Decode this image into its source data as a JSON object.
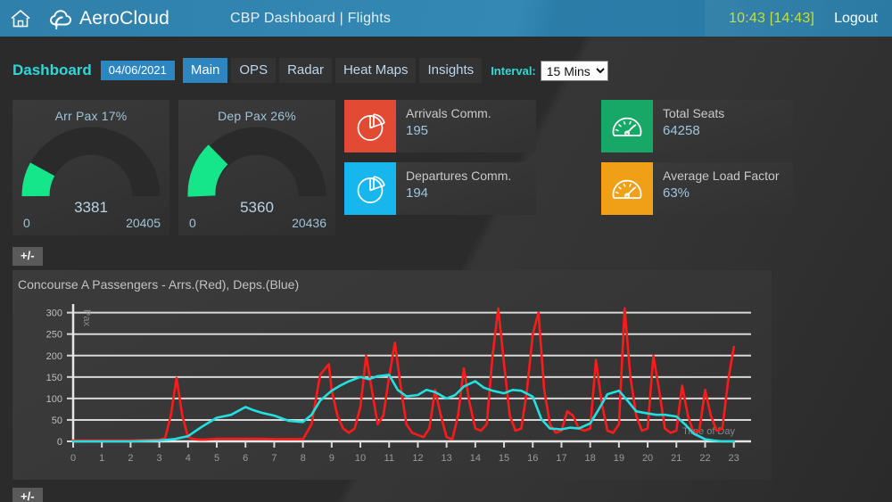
{
  "header": {
    "home_icon": "home-icon",
    "logo_icon": "aerocloud-logo-icon",
    "brand": "AeroCloud",
    "title": "CBP Dashboard | Flights",
    "clock": "10:43 [14:43]",
    "logout": "Logout",
    "clock_color": "#c5de3c",
    "bar_color": "#3389b4"
  },
  "nav": {
    "brand": "Dashboard",
    "date": "04/06/2021",
    "tabs": [
      {
        "label": "Main",
        "active": true
      },
      {
        "label": "OPS",
        "active": false
      },
      {
        "label": "Radar",
        "active": false
      },
      {
        "label": "Heat Maps",
        "active": false
      },
      {
        "label": "Insights",
        "active": false
      }
    ],
    "interval_label": "Interval:",
    "interval_value": "15 Mins",
    "interval_options": [
      "15 Mins"
    ],
    "accent_color": "#2fd8d8",
    "active_tab_color": "#2e86c1"
  },
  "gauges": [
    {
      "title": "Arr Pax 17%",
      "value": "3381",
      "min": "0",
      "max": "20405",
      "percent": 17,
      "arc_color": "#16e68a",
      "track_color": "#2a2a2a"
    },
    {
      "title": "Dep Pax 26%",
      "value": "5360",
      "min": "0",
      "max": "20436",
      "percent": 26,
      "arc_color": "#16e68a",
      "track_color": "#2a2a2a"
    }
  ],
  "tiles": [
    {
      "label": "Arrivals Comm.",
      "value": "195",
      "icon": "pie-chart-icon",
      "color": "#e24a33"
    },
    {
      "label": "Departures Comm.",
      "value": "194",
      "icon": "pie-chart-icon",
      "color": "#17b6ec"
    },
    {
      "label": "Total Seats",
      "value": "64258",
      "icon": "speedometer-icon",
      "color": "#17a766"
    },
    {
      "label": "Average Load Factor",
      "value": "63%",
      "icon": "speedometer-icon",
      "color": "#f0a017"
    }
  ],
  "buttons": {
    "expand_top": "+/-",
    "expand_bottom": "+/-"
  },
  "chart_data": {
    "type": "line",
    "title": "Concourse A Passengers - Arrs.(Red), Deps.(Blue)",
    "xlabel": "Time of Day",
    "ylabel": "Pax",
    "xlim": [
      0,
      23.6
    ],
    "ylim": [
      0,
      320
    ],
    "yticks": [
      0,
      50,
      100,
      150,
      200,
      250,
      300
    ],
    "xticks": [
      0,
      1,
      2,
      3,
      4,
      5,
      6,
      7,
      8,
      9,
      10,
      11,
      12,
      13,
      14,
      15,
      16,
      17,
      18,
      19,
      20,
      21,
      22,
      23
    ],
    "grid": true,
    "legend": "none",
    "series": [
      {
        "name": "Arrivals",
        "color": "#ff1a1a",
        "x": [
          0,
          0.5,
          1,
          1.5,
          2,
          2.5,
          3,
          3.2,
          3.4,
          3.6,
          3.8,
          4.0,
          4.2,
          4.4,
          4.6,
          4.8,
          5,
          5.5,
          6,
          6.5,
          7,
          7.5,
          8,
          8.3,
          8.6,
          8.9,
          9.0,
          9.2,
          9.4,
          9.6,
          9.8,
          10.0,
          10.2,
          10.4,
          10.6,
          10.8,
          11.0,
          11.2,
          11.4,
          11.6,
          11.8,
          12.0,
          12.2,
          12.4,
          12.6,
          12.8,
          13.0,
          13.2,
          13.4,
          13.6,
          13.8,
          14.0,
          14.2,
          14.4,
          14.6,
          14.8,
          15.0,
          15.2,
          15.4,
          15.6,
          15.8,
          16.0,
          16.2,
          16.4,
          16.6,
          16.8,
          17.0,
          17.2,
          17.4,
          17.6,
          17.8,
          18.0,
          18.2,
          18.4,
          18.6,
          18.8,
          19.0,
          19.2,
          19.4,
          19.6,
          19.8,
          20.0,
          20.2,
          20.4,
          20.6,
          20.8,
          21.0,
          21.2,
          21.4,
          21.6,
          21.8,
          22.0,
          22.2,
          22.4,
          22.6,
          22.8,
          23.0,
          23.2,
          23.4
        ],
        "y": [
          2,
          2,
          2,
          2,
          2,
          3,
          4,
          8,
          60,
          148,
          60,
          10,
          5,
          4,
          4,
          5,
          6,
          6,
          6,
          6,
          5,
          5,
          5,
          40,
          155,
          180,
          120,
          60,
          30,
          20,
          30,
          80,
          200,
          120,
          40,
          60,
          150,
          230,
          130,
          40,
          20,
          15,
          10,
          30,
          120,
          60,
          10,
          5,
          60,
          170,
          90,
          30,
          25,
          40,
          200,
          310,
          180,
          60,
          25,
          30,
          120,
          250,
          300,
          120,
          40,
          20,
          25,
          70,
          60,
          30,
          25,
          30,
          190,
          90,
          25,
          20,
          40,
          310,
          150,
          60,
          25,
          30,
          200,
          120,
          30,
          20,
          25,
          130,
          60,
          20,
          25,
          120,
          60,
          25,
          30,
          140,
          220
        ]
      },
      {
        "name": "Departures",
        "color": "#22e0e0",
        "x": [
          0,
          1,
          2,
          3,
          3.5,
          4,
          4.5,
          5,
          5.5,
          6,
          6.3,
          6.6,
          7,
          7.5,
          8,
          8.3,
          8.6,
          9,
          9.3,
          9.6,
          10,
          10.3,
          10.6,
          11,
          11.3,
          11.6,
          12,
          12.3,
          12.6,
          13,
          13.3,
          13.6,
          14,
          14.3,
          14.6,
          15,
          15.3,
          15.6,
          16,
          16.3,
          16.6,
          17,
          17.3,
          17.6,
          18,
          18.3,
          18.6,
          19,
          19.3,
          19.6,
          20,
          20.3,
          20.6,
          21,
          21.3,
          21.6,
          22,
          22.3,
          22.6,
          23
        ],
        "y": [
          0,
          0,
          0,
          2,
          5,
          12,
          35,
          55,
          62,
          80,
          72,
          66,
          60,
          48,
          45,
          62,
          95,
          118,
          130,
          140,
          150,
          145,
          152,
          155,
          120,
          105,
          108,
          120,
          115,
          100,
          108,
          128,
          140,
          125,
          118,
          112,
          120,
          118,
          104,
          52,
          30,
          28,
          32,
          30,
          42,
          75,
          110,
          118,
          95,
          70,
          65,
          62,
          62,
          58,
          40,
          18,
          5,
          2,
          0,
          0
        ]
      }
    ]
  }
}
